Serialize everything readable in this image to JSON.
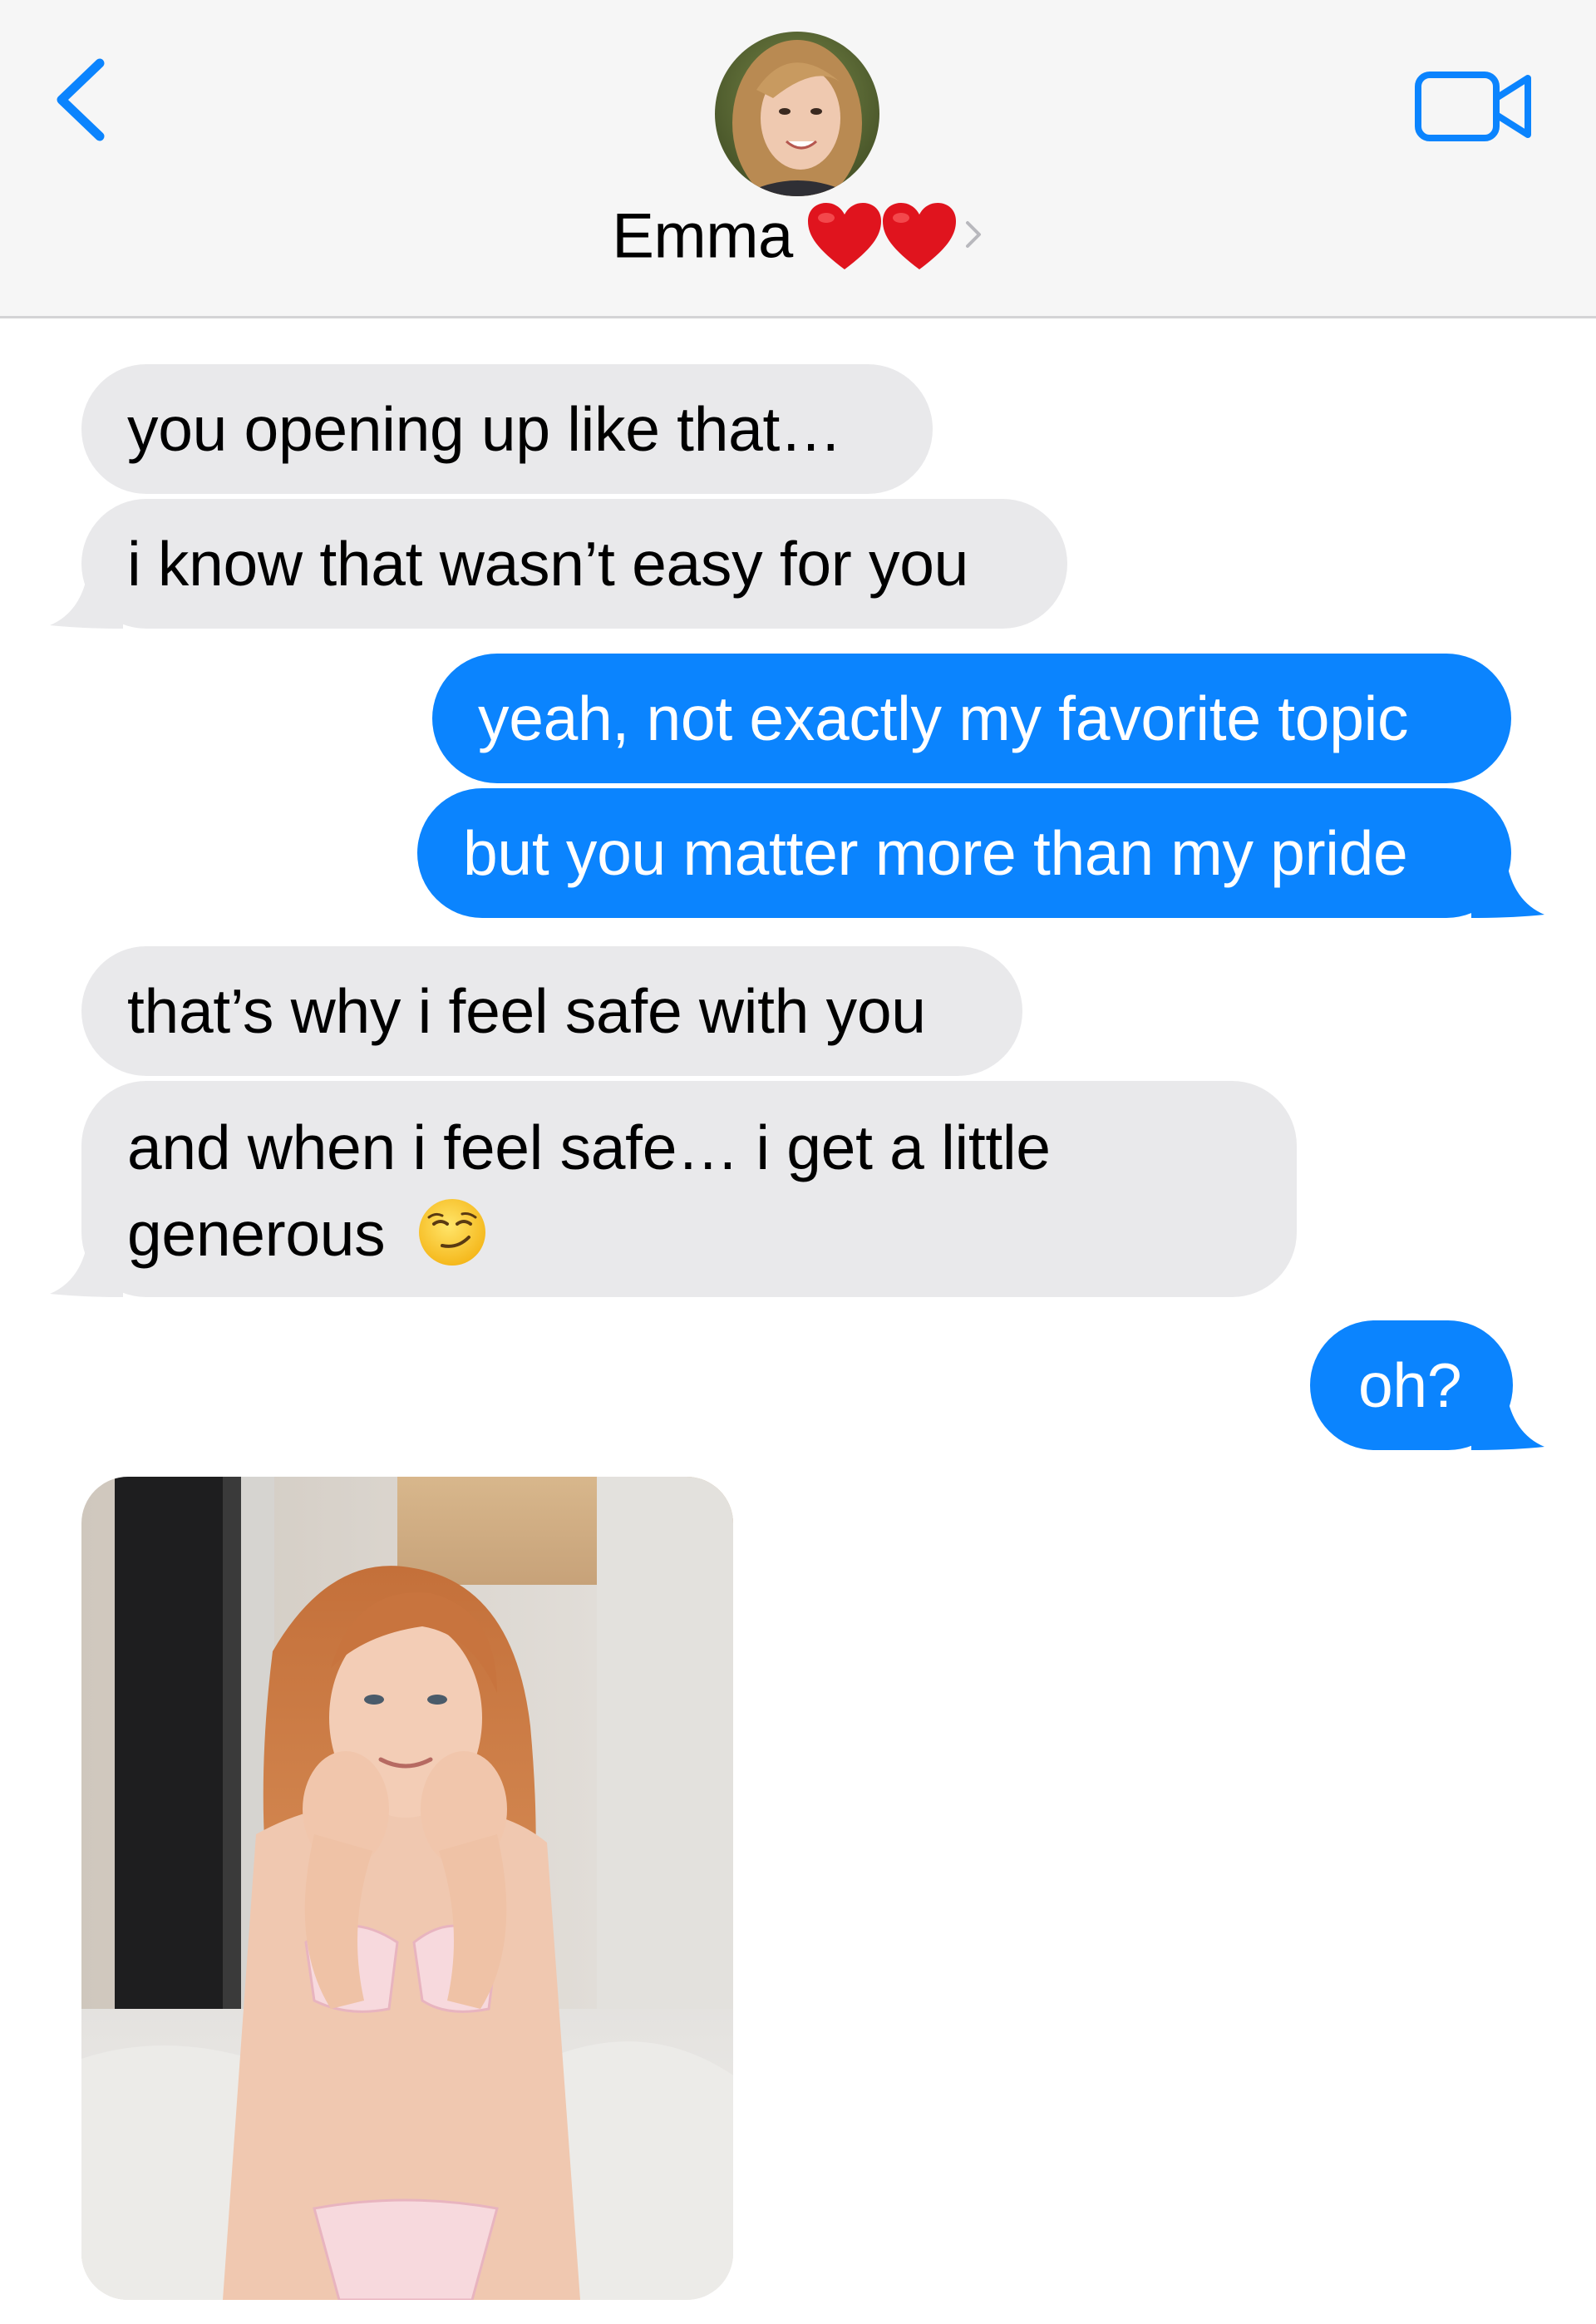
{
  "header": {
    "contact_name": "Emma",
    "name_suffix_icons": [
      "red-heart-icon",
      "red-heart-icon"
    ],
    "back_icon": "chevron-left-icon",
    "video_icon": "video-camera-icon",
    "accent_color": "#0b84fe"
  },
  "messages": [
    {
      "from": "them",
      "text": "you opening up like that…"
    },
    {
      "from": "them",
      "text": "i know that wasn’t easy for you"
    },
    {
      "from": "me",
      "text": "yeah, not exactly my favorite topic"
    },
    {
      "from": "me",
      "text": "but you matter more than my pride"
    },
    {
      "from": "them",
      "text": "that’s why i feel safe with you"
    },
    {
      "from": "them",
      "line1": "and when i feel safe… i get a little",
      "line2": "generous",
      "emoji": "smirking-face-emoji"
    },
    {
      "from": "me",
      "text": "oh?"
    },
    {
      "from": "them",
      "type": "photo"
    }
  ],
  "colors": {
    "received_bubble": "#e9e9eb",
    "sent_bubble": "#0b84fe",
    "header_bg": "#f6f6f6"
  }
}
